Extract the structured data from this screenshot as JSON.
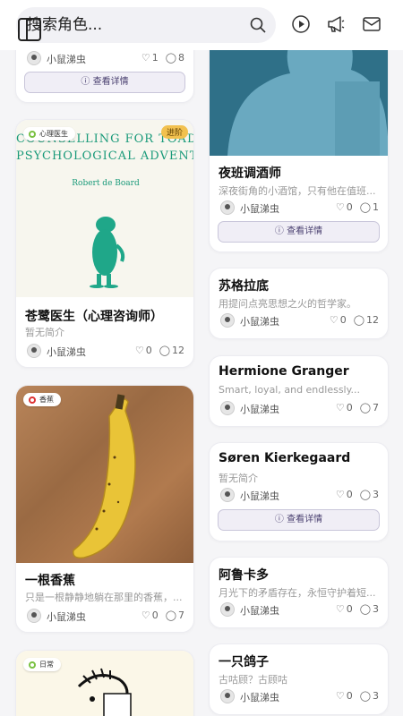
{
  "header": {
    "search_placeholder": "搜索角色...",
    "icons": [
      "sidebar-toggle-icon",
      "search-icon",
      "play-icon",
      "megaphone-icon",
      "mail-icon"
    ]
  },
  "left": [
    {
      "author": "小鼠涕虫",
      "likes": "1",
      "comments": "8",
      "button": "查看详情"
    },
    {
      "tag": "心理医生",
      "badge": "进阶",
      "cover_title": "COUNSELLING FOR TOADS:",
      "cover_subtitle": "PSYCHOLOGICAL ADVENTU",
      "cover_author": "Robert de Board",
      "title": "苍鹭医生（心理咨询师）",
      "desc": "暂无简介",
      "author": "小鼠涕虫",
      "likes": "0",
      "comments": "12"
    },
    {
      "tag": "香蕉",
      "title": "一根香蕉",
      "desc": "只是一根静静地躺在那里的香蕉，...",
      "author": "小鼠涕虫",
      "likes": "0",
      "comments": "7"
    },
    {
      "tag": "日常"
    }
  ],
  "right": [
    {
      "title": "夜班调酒师",
      "desc": "深夜街角的小酒馆，只有他在值班...",
      "author": "小鼠涕虫",
      "likes": "0",
      "comments": "1",
      "button": "查看详情"
    },
    {
      "title": "苏格拉底",
      "desc": "用提问点亮思想之火的哲学家。",
      "author": "小鼠涕虫",
      "likes": "0",
      "comments": "12"
    },
    {
      "title": "Hermione Granger",
      "desc": "Smart, loyal, and endlessly...",
      "author": "小鼠涕虫",
      "likes": "0",
      "comments": "7"
    },
    {
      "title": "Søren Kierkegaard",
      "desc": "暂无简介",
      "author": "小鼠涕虫",
      "likes": "0",
      "comments": "3",
      "button": "查看详情"
    },
    {
      "title": "阿鲁卡多",
      "desc": "月光下的矛盾存在，永恒守护着短...",
      "author": "小鼠涕虫",
      "likes": "0",
      "comments": "3"
    },
    {
      "title": "一只鸽子",
      "desc": "古咕顾？古顾咕",
      "author": "小鼠涕虫",
      "likes": "0",
      "comments": "3"
    }
  ]
}
